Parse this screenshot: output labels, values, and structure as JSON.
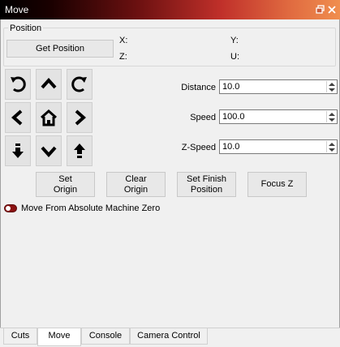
{
  "window": {
    "title": "Move",
    "float_icon": "restore-icon",
    "close_icon": "close-icon",
    "accent": "#c0302a"
  },
  "position": {
    "group_label": "Position",
    "get_button": "Get Position",
    "x_label": "X:",
    "y_label": "Y:",
    "z_label": "Z:",
    "u_label": "U:"
  },
  "jog": {
    "buttons": [
      "rotate-ccw-icon",
      "arrow-up-icon",
      "rotate-cw-icon",
      "arrow-left-icon",
      "home-icon",
      "arrow-right-icon",
      "z-down-icon",
      "arrow-down-icon",
      "z-up-icon"
    ]
  },
  "fields": {
    "distance_label": "Distance",
    "distance_value": "10.0",
    "speed_label": "Speed",
    "speed_value": "100.0",
    "zspeed_label": "Z-Speed",
    "zspeed_value": "10.0"
  },
  "actions": {
    "set_origin": "Set\nOrigin",
    "clear_origin": "Clear\nOrigin",
    "set_finish": "Set Finish\nPosition",
    "focus_z": "Focus Z"
  },
  "toggle": {
    "label": "Move From Absolute Machine Zero",
    "on": false,
    "color": "#8b1212"
  },
  "tabs": [
    {
      "label": "Cuts",
      "active": false
    },
    {
      "label": "Move",
      "active": true
    },
    {
      "label": "Console",
      "active": false
    },
    {
      "label": "Camera Control",
      "active": false
    }
  ]
}
